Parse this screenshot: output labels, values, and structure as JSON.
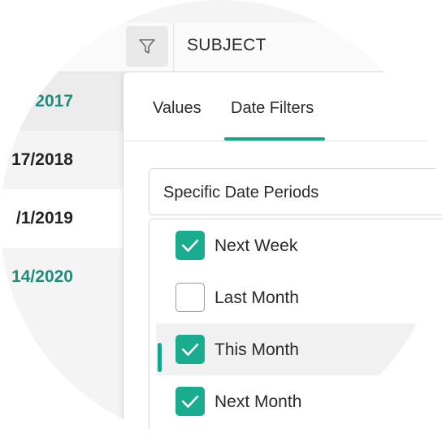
{
  "header": {
    "subject_label": "SUBJECT"
  },
  "rows": [
    {
      "date": "2017",
      "style": "teal"
    },
    {
      "date": "17/2018",
      "style": "dark"
    },
    {
      "date": "/1/2019",
      "style": "dark"
    },
    {
      "date": "14/2020",
      "style": "teal"
    }
  ],
  "filter_panel": {
    "tabs": [
      {
        "label": "Values",
        "active": false
      },
      {
        "label": "Date Filters",
        "active": true
      }
    ],
    "period_select": {
      "value": "Specific Date Periods"
    },
    "options": [
      {
        "label": "Next Week",
        "checked": true,
        "selected": false
      },
      {
        "label": "Last Month",
        "checked": false,
        "selected": false
      },
      {
        "label": "This Month",
        "checked": true,
        "selected": true
      },
      {
        "label": "Next Month",
        "checked": true,
        "selected": false
      }
    ]
  },
  "colors": {
    "accent": "#17a58b",
    "teal_text": "#1f8c7a"
  }
}
